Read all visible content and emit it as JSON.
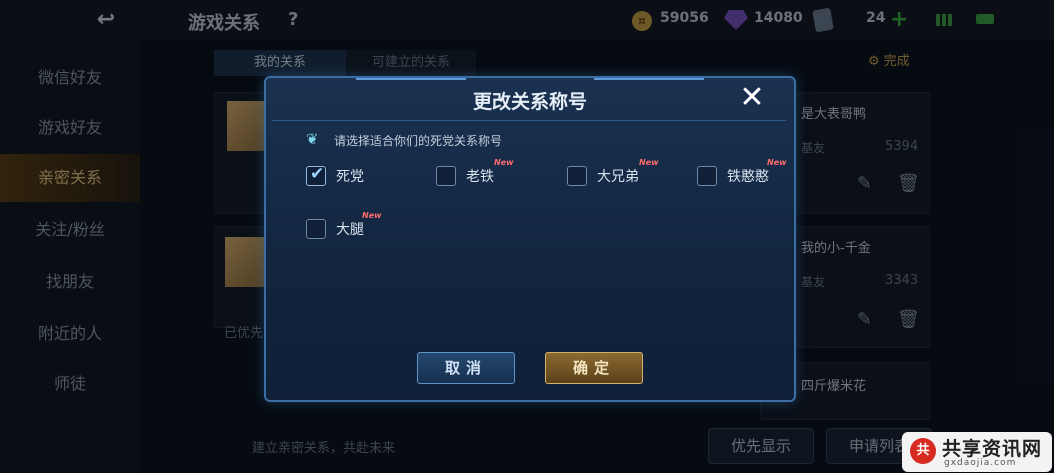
{
  "topbar": {
    "title": "游戏关系",
    "help": "?",
    "coins": "59056",
    "gems": "14080",
    "tickets": "24"
  },
  "sidebar": {
    "items": [
      {
        "label": "微信好友"
      },
      {
        "label": "游戏好友"
      },
      {
        "label": "亲密关系"
      },
      {
        "label": "关注/粉丝"
      },
      {
        "label": "找朋友"
      },
      {
        "label": "附近的人"
      },
      {
        "label": "师徒"
      }
    ]
  },
  "tabs": {
    "mine": "我的关系",
    "can_build": "可建立的关系",
    "done": "完成"
  },
  "cards": [
    {
      "name": "是大表哥鸭",
      "relation": "基友",
      "score": "5394"
    },
    {
      "name": "我的小-千金",
      "relation": "基友",
      "score": "3343"
    },
    {
      "name": "四斤爆米花",
      "relation": "",
      "score": ""
    }
  ],
  "section_label": "已优先",
  "bottom": {
    "hint": "建立亲密关系，共赴未来",
    "priority_btn": "优先显示",
    "apply_btn": "申请列表"
  },
  "watermark": {
    "logo": "共",
    "title": "共享资讯网",
    "url": "gxdaojia.com"
  },
  "dialog": {
    "title": "更改关系称号",
    "close_icon": "✕",
    "hint": "请选择适合你们的死党关系称号",
    "new_badge": "New",
    "options": [
      {
        "label": "死党",
        "checked": true,
        "is_new": false
      },
      {
        "label": "老铁",
        "checked": false,
        "is_new": true
      },
      {
        "label": "大兄弟",
        "checked": false,
        "is_new": true
      },
      {
        "label": "铁憨憨",
        "checked": false,
        "is_new": true
      },
      {
        "label": "大腿",
        "checked": false,
        "is_new": true
      }
    ],
    "cancel": "取消",
    "confirm": "确定"
  }
}
